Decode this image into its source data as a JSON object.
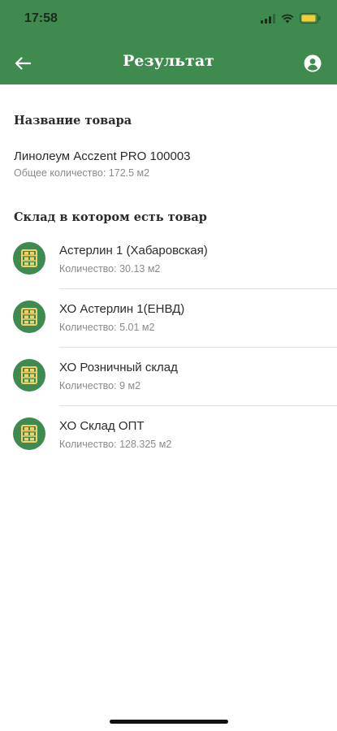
{
  "status_bar": {
    "time": "17:58"
  },
  "header": {
    "title": "Результат",
    "back_icon": "arrow-left-icon",
    "profile_icon": "account-circle-icon"
  },
  "product": {
    "heading": "Название товара",
    "name": "Линолеум Acczent  PRO 100003",
    "total": "Общее количество: 172.5 м2"
  },
  "warehouses": {
    "heading": "Склад в котором есть товар",
    "items": [
      {
        "name": "Астерлин 1 (Хабаровская)",
        "quantity": "Количество: 30.13 м2"
      },
      {
        "name": "ХО Астерлин 1(ЕНВД)",
        "quantity": "Количество: 5.01 м2"
      },
      {
        "name": "ХО Розничный склад",
        "quantity": "Количество: 9 м2"
      },
      {
        "name": "ХО Склад ОПТ",
        "quantity": "Количество: 128.325 м2"
      }
    ]
  },
  "colors": {
    "primary": "#3e8a4f",
    "icon_accent": "#f2d16b"
  }
}
